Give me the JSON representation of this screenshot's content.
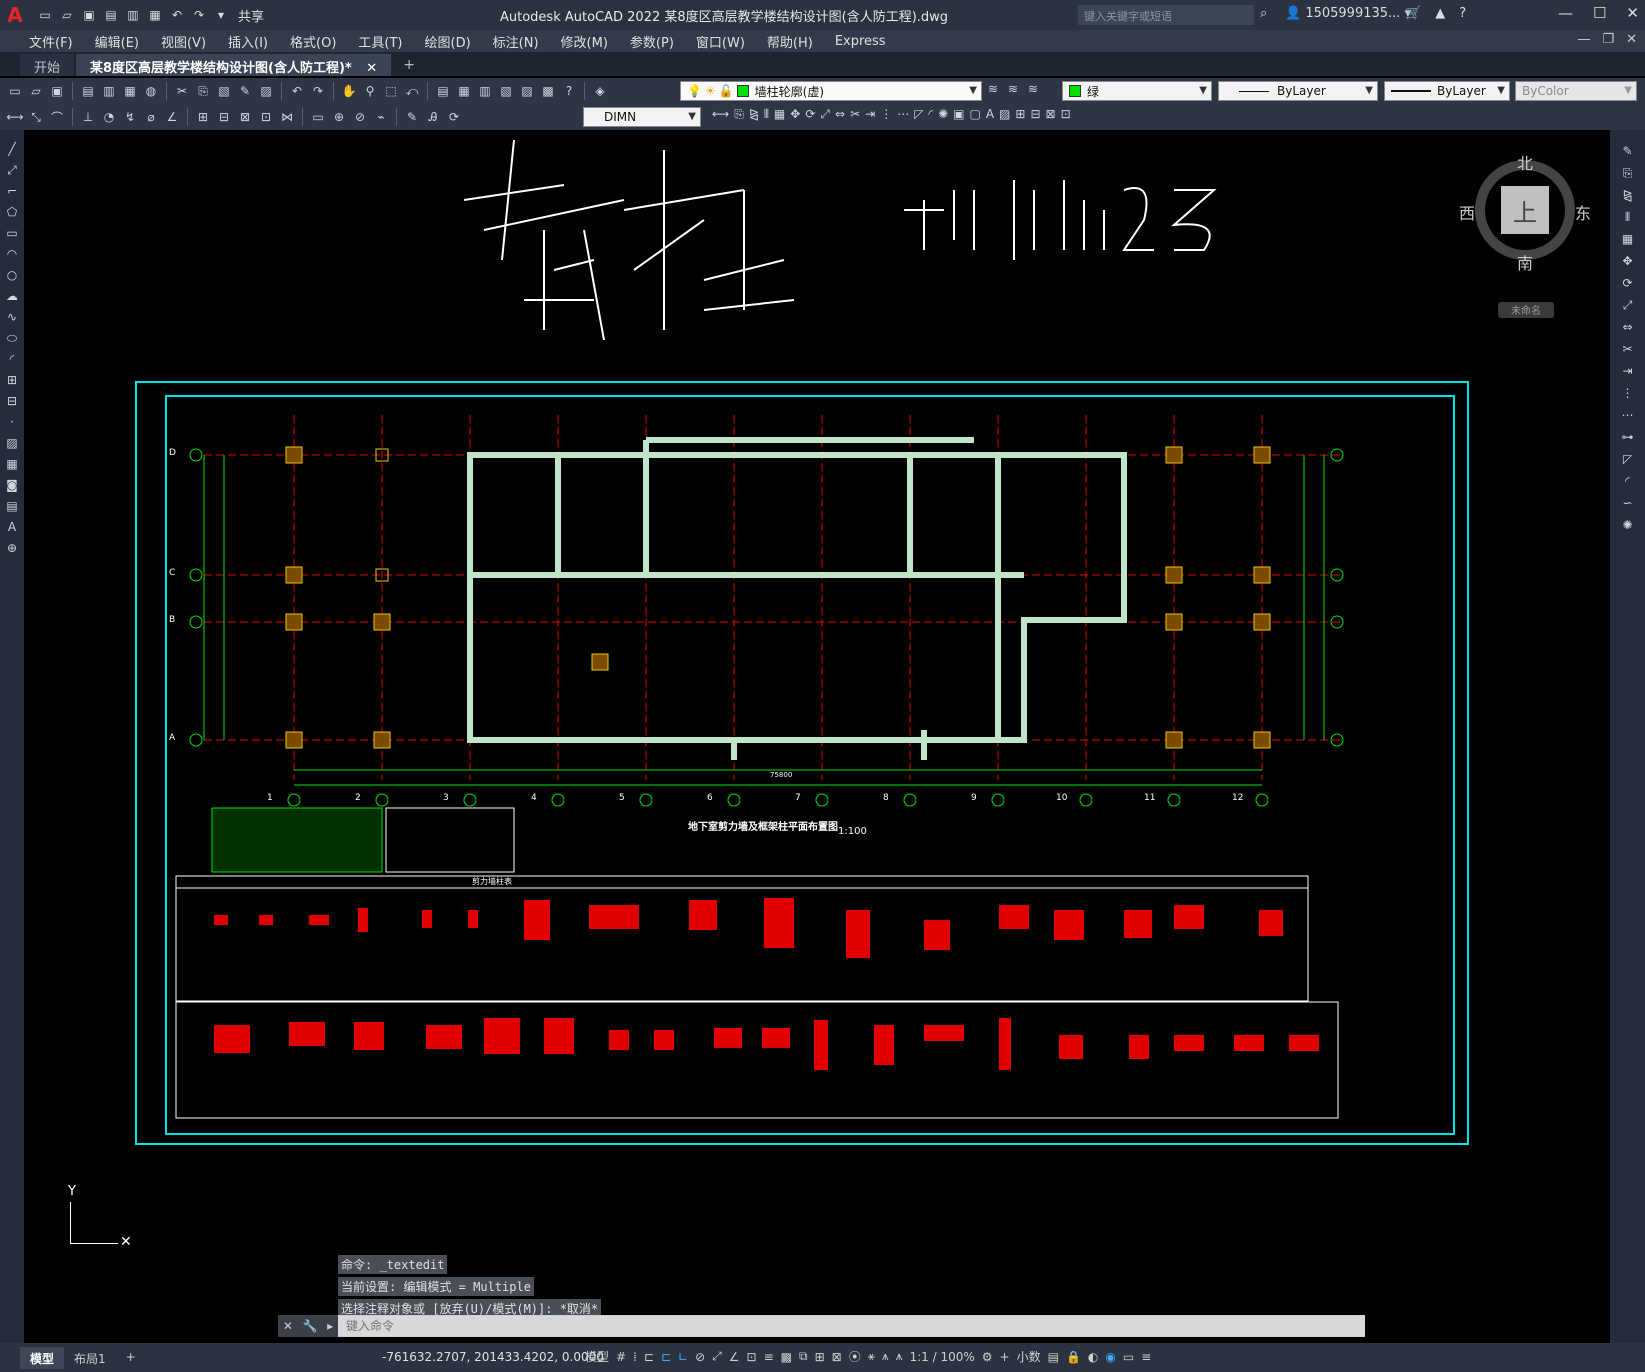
{
  "titlebar": {
    "app_title": "Autodesk AutoCAD 2022    某8度区高层教学楼结构设计图(含人防工程).dwg",
    "share_label": "共享",
    "search_placeholder": "键入关键字或短语",
    "user_name": "1505999135..."
  },
  "menu": {
    "items": [
      "文件(F)",
      "编辑(E)",
      "视图(V)",
      "插入(I)",
      "格式(O)",
      "工具(T)",
      "绘图(D)",
      "标注(N)",
      "修改(M)",
      "参数(P)",
      "窗口(W)",
      "帮助(H)",
      "Express"
    ]
  },
  "filetabs": {
    "start": "开始",
    "active": "某8度区高层教学楼结构设计图(含人防工程)*",
    "plus": "+"
  },
  "toolbar1": {
    "layer": "墙柱轮廓(虚)",
    "color": "绿",
    "linetype": "ByLayer",
    "lineweight": "ByLayer",
    "plotstyle": "ByColor"
  },
  "toolbar2": {
    "dimstyle": "DIMN"
  },
  "drawing": {
    "handwriting_1": "墙柱",
    "handwriting_2": "加长1:1.25",
    "plan_title": "地下室剪力墙及框架柱平面布置图",
    "plan_scale": "1:100",
    "table_title": "剪力墙柱表",
    "axis_numbers": [
      "1",
      "2",
      "3",
      "4",
      "5",
      "6",
      "7",
      "8",
      "9",
      "10",
      "11",
      "12"
    ],
    "axis_letters": [
      "D",
      "C",
      "B",
      "A"
    ],
    "total_dim": "75800"
  },
  "viewcube": {
    "north": "北",
    "south": "南",
    "west": "西",
    "east": "东",
    "face": "上",
    "ucs": "未命名"
  },
  "command": {
    "history": [
      "命令: _textedit",
      "当前设置: 编辑模式 = Multiple",
      "选择注释对象或 [放弃(U)/模式(M)]: *取消*"
    ],
    "placeholder": "键入命令"
  },
  "statusbar": {
    "tab_model": "模型",
    "tab_layout": "布局1",
    "coords": "-761632.2707, 201433.4202, 0.0000",
    "space": "模型",
    "scale": "1:1 / 100%",
    "units": "小数"
  }
}
